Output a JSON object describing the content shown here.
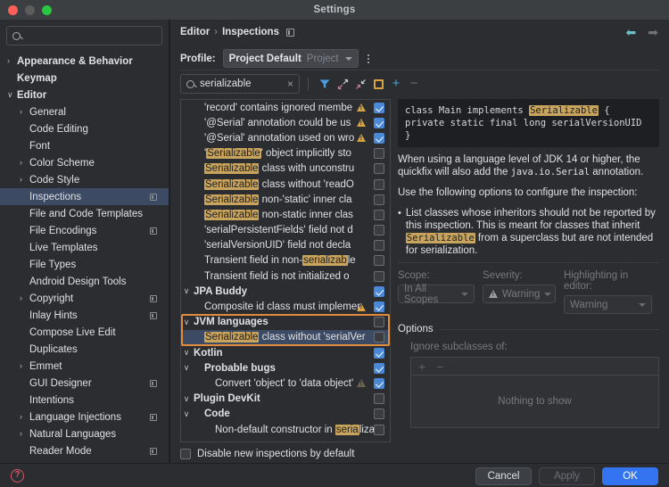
{
  "window": {
    "title": "Settings"
  },
  "sidebar": {
    "search_placeholder": "",
    "items": [
      {
        "label": "Appearance & Behavior",
        "arrow": "›",
        "indent": 0,
        "bold": true,
        "badge": false,
        "selected": false
      },
      {
        "label": "Keymap",
        "arrow": "",
        "indent": 0,
        "bold": true,
        "badge": false,
        "selected": false
      },
      {
        "label": "Editor",
        "arrow": "∨",
        "indent": 0,
        "bold": true,
        "badge": false,
        "selected": false
      },
      {
        "label": "General",
        "arrow": "›",
        "indent": 1,
        "bold": false,
        "badge": false,
        "selected": false
      },
      {
        "label": "Code Editing",
        "arrow": "",
        "indent": 1,
        "bold": false,
        "badge": false,
        "selected": false
      },
      {
        "label": "Font",
        "arrow": "",
        "indent": 1,
        "bold": false,
        "badge": false,
        "selected": false
      },
      {
        "label": "Color Scheme",
        "arrow": "›",
        "indent": 1,
        "bold": false,
        "badge": false,
        "selected": false
      },
      {
        "label": "Code Style",
        "arrow": "›",
        "indent": 1,
        "bold": false,
        "badge": false,
        "selected": false
      },
      {
        "label": "Inspections",
        "arrow": "",
        "indent": 1,
        "bold": false,
        "badge": true,
        "selected": true
      },
      {
        "label": "File and Code Templates",
        "arrow": "",
        "indent": 1,
        "bold": false,
        "badge": false,
        "selected": false
      },
      {
        "label": "File Encodings",
        "arrow": "",
        "indent": 1,
        "bold": false,
        "badge": true,
        "selected": false
      },
      {
        "label": "Live Templates",
        "arrow": "",
        "indent": 1,
        "bold": false,
        "badge": false,
        "selected": false
      },
      {
        "label": "File Types",
        "arrow": "",
        "indent": 1,
        "bold": false,
        "badge": false,
        "selected": false
      },
      {
        "label": "Android Design Tools",
        "arrow": "",
        "indent": 1,
        "bold": false,
        "badge": false,
        "selected": false
      },
      {
        "label": "Copyright",
        "arrow": "›",
        "indent": 1,
        "bold": false,
        "badge": true,
        "selected": false
      },
      {
        "label": "Inlay Hints",
        "arrow": "",
        "indent": 1,
        "bold": false,
        "badge": true,
        "selected": false
      },
      {
        "label": "Compose Live Edit",
        "arrow": "",
        "indent": 1,
        "bold": false,
        "badge": false,
        "selected": false
      },
      {
        "label": "Duplicates",
        "arrow": "",
        "indent": 1,
        "bold": false,
        "badge": false,
        "selected": false
      },
      {
        "label": "Emmet",
        "arrow": "›",
        "indent": 1,
        "bold": false,
        "badge": false,
        "selected": false
      },
      {
        "label": "GUI Designer",
        "arrow": "",
        "indent": 1,
        "bold": false,
        "badge": true,
        "selected": false
      },
      {
        "label": "Intentions",
        "arrow": "",
        "indent": 1,
        "bold": false,
        "badge": false,
        "selected": false
      },
      {
        "label": "Language Injections",
        "arrow": "›",
        "indent": 1,
        "bold": false,
        "badge": true,
        "selected": false
      },
      {
        "label": "Natural Languages",
        "arrow": "›",
        "indent": 1,
        "bold": false,
        "badge": false,
        "selected": false
      },
      {
        "label": "Reader Mode",
        "arrow": "",
        "indent": 1,
        "bold": false,
        "badge": true,
        "selected": false
      }
    ]
  },
  "breadcrumb": {
    "parent": "Editor",
    "separator": "›",
    "current": "Inspections"
  },
  "profile": {
    "label": "Profile:",
    "value": "Project Default",
    "scope_note": "Project"
  },
  "search": {
    "value": "serializable",
    "clear": "×"
  },
  "toolbar_icons": [
    "filter-icon",
    "expand-all-icon",
    "collapse-all-icon",
    "reset-icon",
    "add-icon",
    "remove-icon"
  ],
  "inspections": [
    {
      "text": "'record' contains ignored membe",
      "highlight": "",
      "pre": "",
      "post": "",
      "indent": 0,
      "arrow": "",
      "bold": false,
      "warn": "on",
      "checked": true,
      "selected": false
    },
    {
      "text": "'@Serial' annotation could be us",
      "indent": 0,
      "arrow": "",
      "bold": false,
      "warn": "on",
      "checked": true,
      "selected": false
    },
    {
      "text": "'@Serial' annotation used on wro",
      "indent": 0,
      "arrow": "",
      "bold": false,
      "warn": "on",
      "checked": true,
      "selected": false
    },
    {
      "pre": "'",
      "highlight": "Serializable",
      "post": "' object implicitly sto",
      "indent": 0,
      "arrow": "",
      "bold": false,
      "warn": "",
      "checked": false,
      "selected": false
    },
    {
      "pre": "",
      "highlight": "Serializable",
      "post": " class with unconstru",
      "indent": 0,
      "arrow": "",
      "bold": false,
      "warn": "",
      "checked": false,
      "selected": false
    },
    {
      "pre": "",
      "highlight": "Serializable",
      "post": " class without 'readO",
      "indent": 0,
      "arrow": "",
      "bold": false,
      "warn": "",
      "checked": false,
      "selected": false
    },
    {
      "pre": "",
      "highlight": "Serializable",
      "post": " non-'static' inner cla",
      "indent": 0,
      "arrow": "",
      "bold": false,
      "warn": "",
      "checked": false,
      "selected": false
    },
    {
      "pre": "",
      "highlight": "Serializable",
      "post": " non-static inner clas",
      "indent": 0,
      "arrow": "",
      "bold": false,
      "warn": "",
      "checked": false,
      "selected": false
    },
    {
      "text": "'serialPersistentFields' field not d",
      "indent": 0,
      "arrow": "",
      "bold": false,
      "warn": "",
      "checked": false,
      "selected": false
    },
    {
      "text": "'serialVersionUID' field not decla",
      "indent": 0,
      "arrow": "",
      "bold": false,
      "warn": "",
      "checked": false,
      "selected": false
    },
    {
      "pre": "Transient field in non-",
      "highlight": "serializab",
      "post": "le",
      "indent": 0,
      "arrow": "",
      "bold": false,
      "warn": "",
      "checked": false,
      "selected": false
    },
    {
      "text": "Transient field is not initialized o",
      "indent": 0,
      "arrow": "",
      "bold": false,
      "warn": "",
      "checked": false,
      "selected": false
    },
    {
      "text": "JPA Buddy",
      "indent": -1,
      "arrow": "∨",
      "bold": true,
      "warn": "",
      "checked": true,
      "selected": false
    },
    {
      "text": "Composite id class must implemen",
      "indent": 0,
      "arrow": "",
      "bold": false,
      "warn": "on",
      "checked": true,
      "selected": false
    },
    {
      "text": "JVM languages",
      "indent": -1,
      "arrow": "∨",
      "bold": true,
      "warn": "",
      "checked": false,
      "selected": false,
      "focus_top": true
    },
    {
      "pre": "",
      "highlight": "Serializable",
      "post": " class without 'serialVer",
      "indent": 0,
      "arrow": "",
      "bold": false,
      "warn": "",
      "checked": false,
      "selected": true,
      "focus_bottom": true
    },
    {
      "text": "Kotlin",
      "indent": -1,
      "arrow": "∨",
      "bold": true,
      "warn": "",
      "checked": true,
      "selected": false
    },
    {
      "text": "Probable bugs",
      "indent": 0,
      "arrow": "∨",
      "bold": true,
      "warn": "",
      "checked": true,
      "selected": false
    },
    {
      "text": "Convert 'object' to 'data object'",
      "indent": 1,
      "arrow": "",
      "bold": false,
      "warn": "dim",
      "checked": true,
      "selected": false
    },
    {
      "text": "Plugin DevKit",
      "indent": -1,
      "arrow": "∨",
      "bold": true,
      "warn": "",
      "checked": false,
      "selected": false
    },
    {
      "text": "Code",
      "indent": 0,
      "arrow": "∨",
      "bold": true,
      "warn": "",
      "checked": false,
      "selected": false
    },
    {
      "pre": "Non-default constructor in ",
      "highlight": "seria",
      "post": "lizal",
      "indent": 1,
      "arrow": "",
      "bold": false,
      "warn": "",
      "checked": false,
      "selected": false
    }
  ],
  "detail": {
    "code": {
      "line1_pre": "class Main implements ",
      "line1_hl": "Serializable",
      "line1_post": " {",
      "line2": "   private static final long serialVersionUID",
      "line3": "}"
    },
    "para1_a": "When using a language level of JDK 14 or higher, the quickfix will also add the ",
    "para1_mono": "java.io.Serial",
    "para1_b": " annotation.",
    "para2": "Use the following options to configure the inspection:",
    "bullet_dot": "•",
    "bullet_a": "List classes whose inheritors should not be reported by this inspection. This is meant for classes that inherit ",
    "bullet_hl": "Serializable",
    "bullet_b": " from a superclass but are not intended for serialization."
  },
  "fields": {
    "scope_label": "Scope:",
    "scope_value": "In All Scopes",
    "severity_label": "Severity:",
    "severity_value": "Warning",
    "highlight_label": "Highlighting in editor:",
    "highlight_value": "Warning"
  },
  "options": {
    "title": "Options",
    "subtitle": "Ignore subclasses of:",
    "add": "+",
    "remove": "−",
    "empty_text": "Nothing to show"
  },
  "footer": {
    "disable_checkbox_label": "Disable new inspections by default",
    "help": "?",
    "cancel": "Cancel",
    "apply": "Apply",
    "ok": "OK"
  },
  "colors": {
    "accent_blue": "#3574f0",
    "selection_blue": "#3c4a64",
    "focus_orange": "#e08c3e",
    "highlight_amber": "#c9a45c",
    "warning_yellow": "#d9a441"
  }
}
